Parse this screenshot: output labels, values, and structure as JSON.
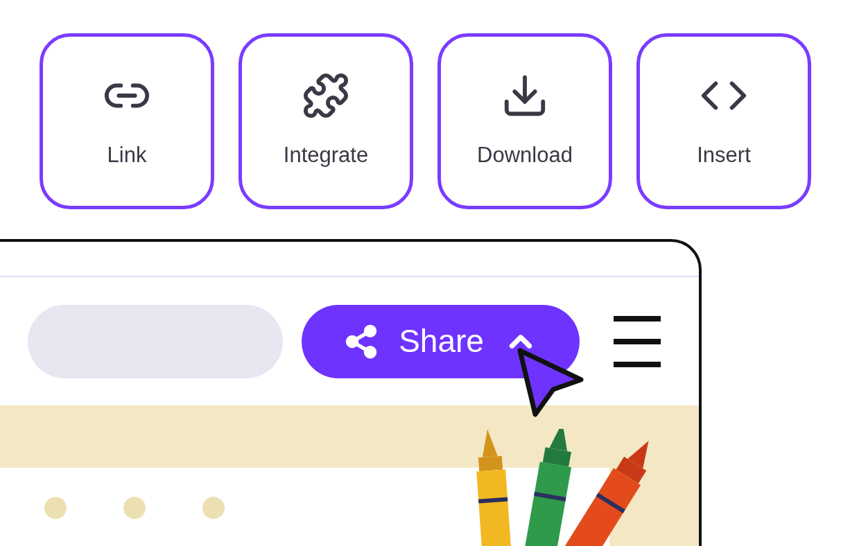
{
  "actions": [
    {
      "kind": "link",
      "label": "Link"
    },
    {
      "kind": "integrate",
      "label": "Integrate"
    },
    {
      "kind": "download",
      "label": "Download"
    },
    {
      "kind": "insert",
      "label": "Insert"
    }
  ],
  "toolbar": {
    "share_button": {
      "label": "Share"
    }
  }
}
